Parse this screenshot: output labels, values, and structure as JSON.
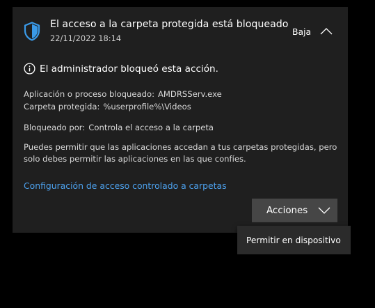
{
  "notification": {
    "title": "El acceso a la carpeta protegida está bloqueado",
    "timestamp": "22/11/2022 18:14",
    "collapse_label": "Baja",
    "info_message": "El administrador bloqueó esta acción.",
    "details": {
      "app_label": "Aplicación o proceso bloqueado:",
      "app_value": "AMDRSServ.exe",
      "folder_label": "Carpeta protegida:",
      "folder_value": "%userprofile%\\Videos",
      "blocked_by_label": "Bloqueado por:",
      "blocked_by_value": "Controla el acceso a la carpeta"
    },
    "description": "Puedes permitir que las aplicaciones accedan a tus carpetas protegidas, pero solo debes permitir las aplicaciones en las que confíes.",
    "settings_link": "Configuración de acceso controlado a carpetas",
    "actions_label": "Acciones"
  },
  "dropdown": {
    "items": [
      {
        "label": "Permitir en dispositivo"
      }
    ]
  },
  "icons": {
    "shield": "shield-icon",
    "info": "info-icon",
    "collapse": "chevron-up-icon",
    "expand": "chevron-down-icon"
  },
  "colors": {
    "background": "#000000",
    "panel": "#1f1f1f",
    "link": "#4ca0ec",
    "shield_accent": "#3a9ae8",
    "button": "#464646",
    "dropdown": "#2b2b2b"
  }
}
